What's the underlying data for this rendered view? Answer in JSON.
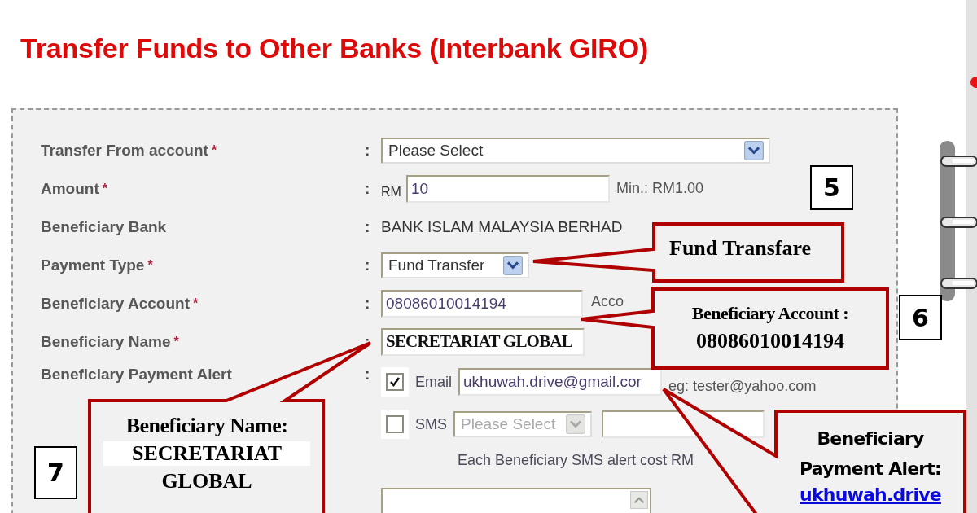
{
  "title": "Transfer Funds to Other Banks (Interbank GIRO)",
  "fields": [
    {
      "kind": "select",
      "label": "Transfer From account",
      "required_mark": "*",
      "separator": ":",
      "value": "Please Select"
    },
    {
      "kind": "amount",
      "label": "Amount",
      "required_mark": "*",
      "separator": ":",
      "prefix": "RM",
      "value": "10",
      "hint": "Min.: RM1.00"
    },
    {
      "kind": "static",
      "label": "Beneficiary Bank",
      "separator": ":",
      "value": "BANK ISLAM MALAYSIA BERHAD"
    },
    {
      "kind": "small_select",
      "label": "Payment Type",
      "required_mark": "*",
      "separator": ":",
      "value": "Fund Transfer"
    },
    {
      "kind": "text",
      "label": "Beneficiary Account",
      "required_mark": "*",
      "separator": ":",
      "value": "08086010014194",
      "hint": "Acco"
    },
    {
      "kind": "name",
      "label": "Beneficiary Name",
      "required_mark": "*",
      "separator": ":",
      "value": "SECRETARIAT GLOBAL"
    },
    {
      "kind": "alert",
      "label": "Beneficiary Payment Alert",
      "separator": ":"
    }
  ],
  "alert": {
    "email": {
      "label": "Email",
      "checked": true,
      "value": "ukhuwah.drive@gmail.cor",
      "hint": "eg: tester@yahoo.com"
    },
    "sms": {
      "label": "SMS",
      "checked": false,
      "disabled": true,
      "placeholder": "Please Select"
    },
    "note": "Each Beneficiary SMS alert cost RM"
  },
  "callouts": [
    {
      "kind": "payment_type",
      "lines": [
        "Fund Transfare"
      ]
    },
    {
      "kind": "account",
      "lines": [
        "Beneficiary Account :",
        "08086010014194"
      ]
    },
    {
      "kind": "name",
      "lines": [
        "Beneficiary Name:",
        "SECRETARIAT",
        "GLOBAL"
      ]
    },
    {
      "kind": "alert",
      "lines": [
        "Beneficiary Payment Alert:"
      ],
      "link": "ukhuwah.drive"
    }
  ],
  "step_numbers": [
    "5",
    "6",
    "7"
  ]
}
